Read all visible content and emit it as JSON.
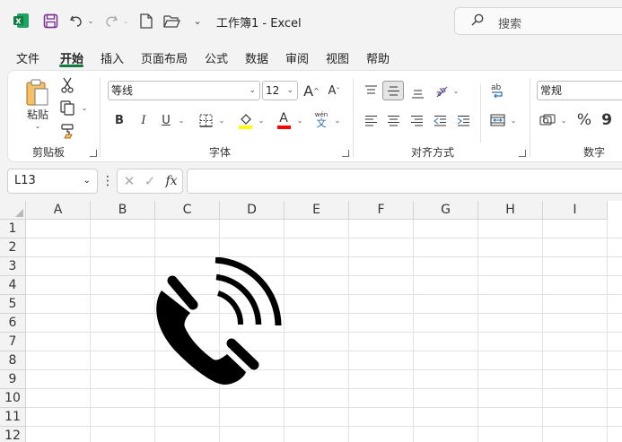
{
  "title_bar": {
    "app_logo": "excel-logo-icon",
    "doc_title": "工作簿1  -  Excel",
    "search_placeholder": "搜索"
  },
  "menu": [
    "文件",
    "开始",
    "插入",
    "页面布局",
    "公式",
    "数据",
    "审阅",
    "视图",
    "帮助"
  ],
  "active_menu": "开始",
  "ribbon": {
    "clipboard": {
      "paste_label": "粘贴",
      "group_label": "剪贴板"
    },
    "font": {
      "font_name": "等线",
      "font_size": "12",
      "bold": "B",
      "italic": "I",
      "underline": "U",
      "font_color_glyph": "A",
      "phonetic_glyph": "文",
      "phonetic_top": "wén",
      "group_label": "字体"
    },
    "alignment": {
      "group_label": "对齐方式"
    },
    "number": {
      "format": "常规",
      "percent": "%",
      "comma": "9",
      "group_label": "数字"
    }
  },
  "formula_bar": {
    "name_box": "L13",
    "fx_label": "fx",
    "formula_value": ""
  },
  "sheet": {
    "columns": [
      "A",
      "B",
      "C",
      "D",
      "E",
      "F",
      "G",
      "H",
      "I"
    ],
    "rows": [
      "1",
      "2",
      "3",
      "4",
      "5",
      "6",
      "7",
      "8",
      "9",
      "10",
      "11",
      "12"
    ],
    "image": "phone-call-icon"
  },
  "colors": {
    "accent": "#107c41",
    "highlight": "#ffff00",
    "font_color": "#ff0000"
  }
}
